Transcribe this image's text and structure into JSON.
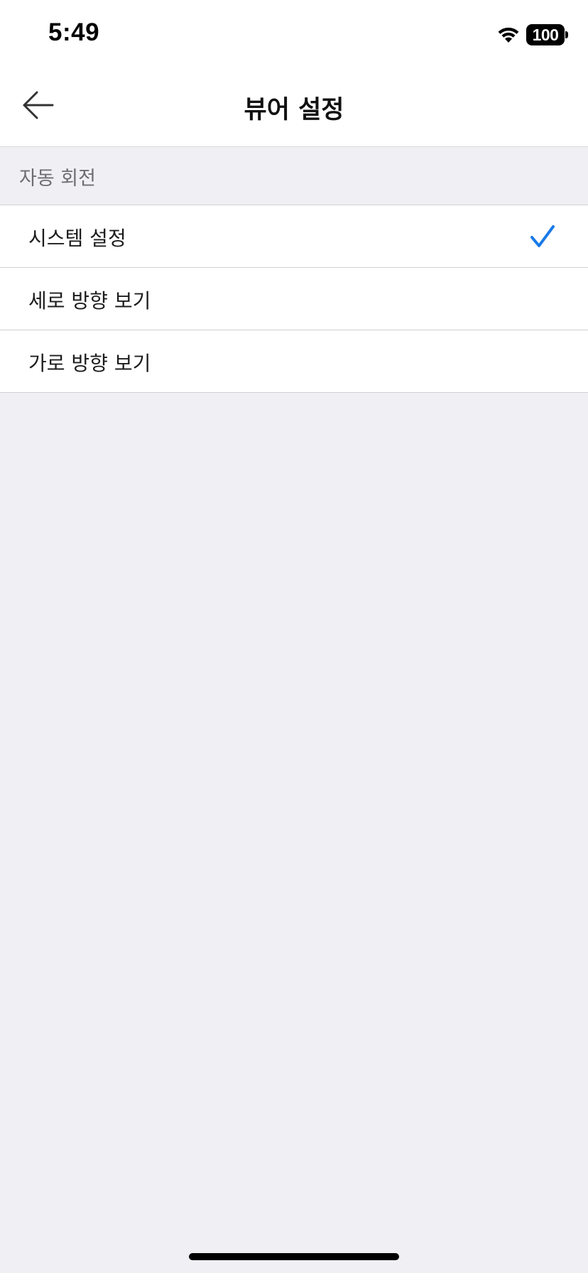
{
  "status_bar": {
    "time": "5:49",
    "battery": "100",
    "wifi_icon": "wifi-icon"
  },
  "nav": {
    "back_icon": "arrow-left-icon",
    "title": "뷰어 설정"
  },
  "section": {
    "title": "자동 회전"
  },
  "options": [
    {
      "label": "시스템 설정",
      "selected": true
    },
    {
      "label": "세로 방향 보기",
      "selected": false
    },
    {
      "label": "가로 방향 보기",
      "selected": false
    }
  ],
  "colors": {
    "accent": "#1a7ae8",
    "background": "#efeff4"
  }
}
